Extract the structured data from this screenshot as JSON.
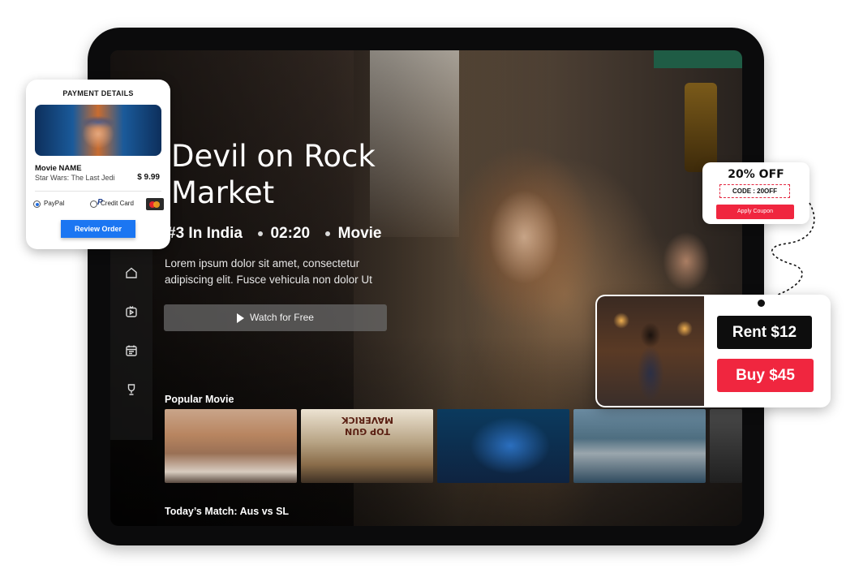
{
  "hero": {
    "title_line1": "Devil on Rock",
    "title_line2": "Market",
    "rank": "#3 In India",
    "duration": "02:20",
    "category": "Movie",
    "description": "Lorem ipsum dolor sit amet, consectetur adipiscing elit. Fusce vehicula non dolor Ut",
    "watch_label": "Watch for Free"
  },
  "sidebar": {
    "items": [
      {
        "icon": "home-icon"
      },
      {
        "icon": "tv-icon"
      },
      {
        "icon": "calendar-icon"
      },
      {
        "icon": "trophy-icon"
      }
    ]
  },
  "sections": {
    "popular": "Popular Movie",
    "match": "Today’s Match: Aus vs SL"
  },
  "popular_movies": [
    {
      "logo": ""
    },
    {
      "logo": "TOP GUN MAVERICK"
    },
    {
      "logo": ""
    },
    {
      "logo": ""
    }
  ],
  "payment": {
    "title": "PAYMENT DETAILS",
    "movie_name": "Movie NAME",
    "movie_subtitle": "Star Wars: The Last Jedi",
    "price": "$ 9.99",
    "option_paypal": "PayPal",
    "option_card": "Credit Card",
    "review_label": "Review Order"
  },
  "coupon": {
    "title": "20% OFF",
    "code": "CODE : 20OFF",
    "apply_label": "Apply Coupon"
  },
  "purchase": {
    "rent_label": "Rent $12",
    "buy_label": "Buy $45"
  },
  "colors": {
    "accent_red": "#f0263f",
    "accent_blue": "#1b76f2",
    "tablet": "#0b0b0c"
  }
}
